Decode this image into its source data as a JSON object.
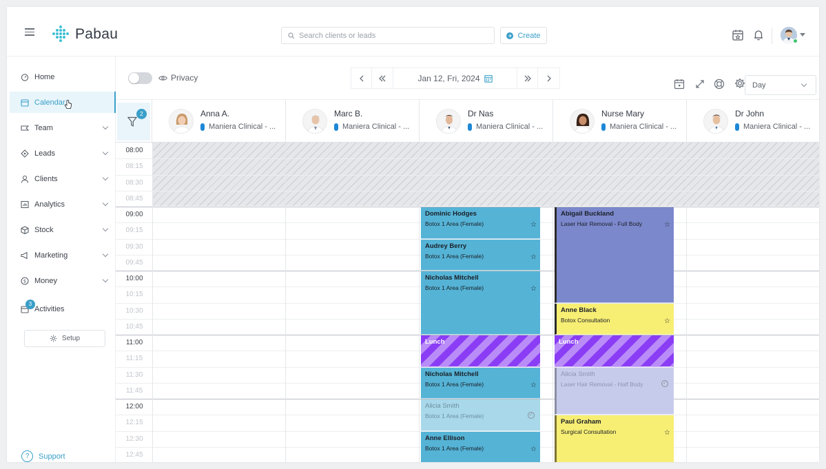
{
  "app": {
    "name": "Pabau",
    "search_placeholder": "Search clients or leads",
    "create_label": "Create"
  },
  "sidebar": {
    "items": [
      {
        "label": "Home",
        "icon": "home-icon",
        "active": false,
        "expandable": false
      },
      {
        "label": "Calendar",
        "icon": "calendar-icon",
        "active": true,
        "expandable": false
      },
      {
        "label": "Team",
        "icon": "team-icon",
        "active": false,
        "expandable": true
      },
      {
        "label": "Leads",
        "icon": "leads-icon",
        "active": false,
        "expandable": true
      },
      {
        "label": "Clients",
        "icon": "clients-icon",
        "active": false,
        "expandable": true
      },
      {
        "label": "Analytics",
        "icon": "analytics-icon",
        "active": false,
        "expandable": true
      },
      {
        "label": "Stock",
        "icon": "stock-icon",
        "active": false,
        "expandable": true
      },
      {
        "label": "Marketing",
        "icon": "marketing-icon",
        "active": false,
        "expandable": true
      },
      {
        "label": "Money",
        "icon": "money-icon",
        "active": false,
        "expandable": true
      },
      {
        "label": "Activities",
        "icon": "activities-icon",
        "active": false,
        "expandable": false
      }
    ],
    "activities_badge": "3",
    "setup_label": "Setup",
    "support_label": "Support"
  },
  "toolbar": {
    "privacy_label": "Privacy",
    "date_label": "Jan 12, Fri, 2024",
    "view_label": "Day"
  },
  "calendar": {
    "filter_badge": "2",
    "staff": [
      {
        "name": "Anna A.",
        "location": "Maniera Clinical - ..."
      },
      {
        "name": "Marc B.",
        "location": "Maniera Clinical - ..."
      },
      {
        "name": "Dr Nas",
        "location": "Maniera Clinical - ..."
      },
      {
        "name": "Nurse Mary",
        "location": "Maniera Clinical - ..."
      },
      {
        "name": "Dr John",
        "location": "Maniera Clinical - ..."
      }
    ],
    "slots": [
      "08:00",
      "08:15",
      "08:30",
      "08:45",
      "09:00",
      "09:15",
      "09:30",
      "09:45",
      "10:00",
      "10:15",
      "10:30",
      "10:45",
      "11:00",
      "11:15",
      "11:30",
      "11:45",
      "12:00",
      "12:15",
      "12:30",
      "12:45"
    ],
    "appointments": [
      {
        "staff": 2,
        "start": "09:00",
        "end": "09:30",
        "client": "Dominic Hodges",
        "service": "Botox 1 Area (Female)",
        "style": "blue",
        "marker": "star"
      },
      {
        "staff": 2,
        "start": "09:30",
        "end": "10:00",
        "client": "Audrey Berry",
        "service": "Botox 1 Area (Female)",
        "style": "blue",
        "marker": "star"
      },
      {
        "staff": 2,
        "start": "10:00",
        "end": "11:00",
        "client": "Nicholas Mitchell",
        "service": "Botox 1 Area (Female)",
        "style": "blue",
        "marker": "star"
      },
      {
        "staff": 2,
        "start": "11:00",
        "end": "11:30",
        "client": "Lunch",
        "service": "",
        "style": "lunch",
        "marker": ""
      },
      {
        "staff": 2,
        "start": "11:30",
        "end": "12:00",
        "client": "Nicholas Mitchell",
        "service": "Botox 1 Area (Female)",
        "style": "blue",
        "marker": "star"
      },
      {
        "staff": 2,
        "start": "12:00",
        "end": "12:30",
        "client": "Alicia Smith",
        "service": "Botox 1 Area (Female)",
        "style": "blue-faded",
        "marker": "check"
      },
      {
        "staff": 2,
        "start": "12:30",
        "end": "13:00",
        "client": "Anne Ellison",
        "service": "Botox 1 Area (Female)",
        "style": "blue",
        "marker": "star"
      },
      {
        "staff": 3,
        "start": "09:00",
        "end": "10:30",
        "client": "Abigail Buckland",
        "service": "Laser Hair Removal - Full Body",
        "style": "violet",
        "marker": "star"
      },
      {
        "staff": 3,
        "start": "10:30",
        "end": "11:00",
        "client": "Anne Black",
        "service": "Botox Consultation",
        "style": "yellow",
        "marker": "star"
      },
      {
        "staff": 3,
        "start": "11:00",
        "end": "11:30",
        "client": "Lunch",
        "service": "",
        "style": "lunch",
        "marker": ""
      },
      {
        "staff": 3,
        "start": "11:30",
        "end": "12:15",
        "client": "Alicia Smith",
        "service": "Laser Hair Removal - Half Body",
        "style": "violet-faded",
        "marker": "check"
      },
      {
        "staff": 3,
        "start": "12:15",
        "end": "13:00",
        "client": "Paul Graham",
        "service": "Surgical Consultation",
        "style": "yellow-b",
        "marker": "star"
      }
    ]
  },
  "colors": {
    "accent": "#3a9fc9",
    "appointment_blue": "#55b3d6",
    "appointment_violet": "#7b88cc",
    "appointment_yellow": "#f7ee74",
    "lunch_purple": "#7b2ff0"
  }
}
